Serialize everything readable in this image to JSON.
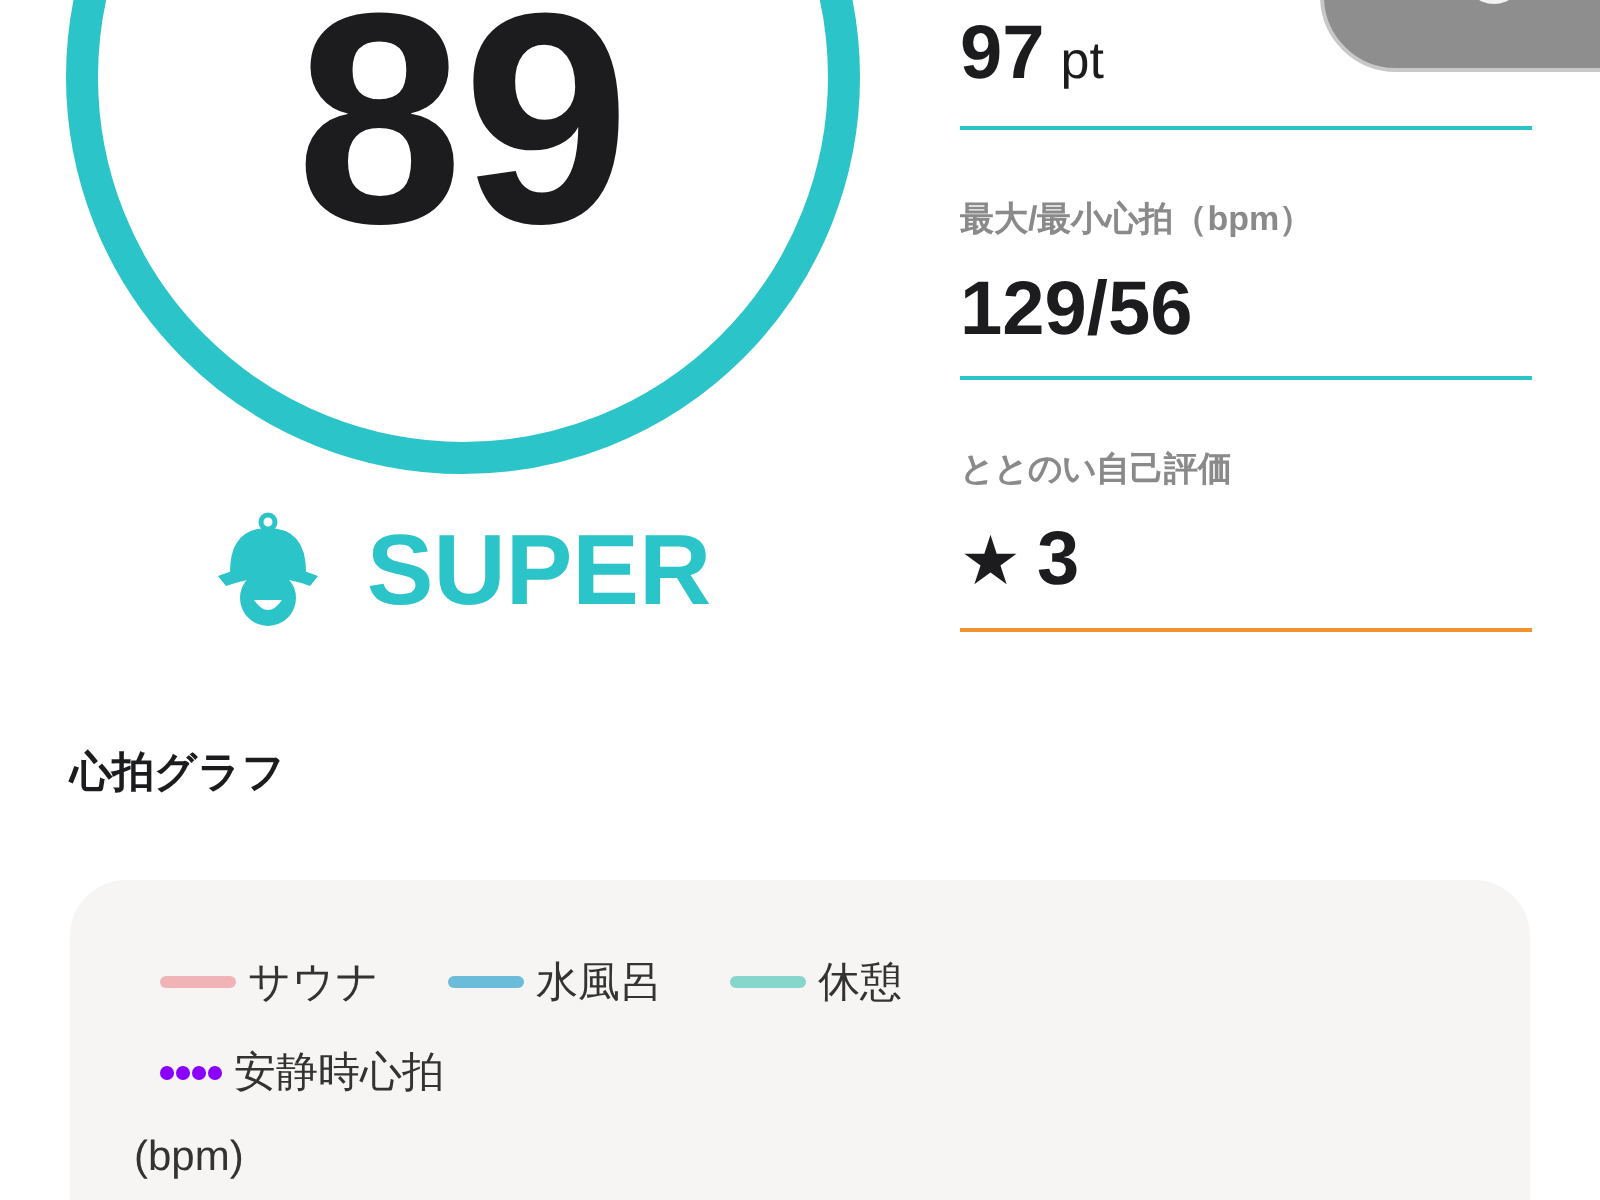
{
  "score": {
    "value": "89",
    "grade": "SUPER"
  },
  "stats": [
    {
      "kind": "points",
      "value": "97",
      "unit": "pt",
      "color": "#2bc4c8"
    },
    {
      "kind": "plain",
      "label": "最大/最小心拍（bpm）",
      "value": "129/56",
      "color": "#2bc4c8"
    },
    {
      "kind": "rating",
      "label": "ととのい自己評価",
      "symbol": "★",
      "value": "3",
      "color": "#f0922e"
    }
  ],
  "heart_rate_graph": {
    "title": "心拍グラフ",
    "legend": [
      {
        "kind": "line",
        "label": "サウナ",
        "color": "#f0b4b8"
      },
      {
        "kind": "line",
        "label": "水風呂",
        "color": "#6bbcd9"
      },
      {
        "kind": "line",
        "label": "休憩",
        "color": "#86d6cc"
      },
      {
        "kind": "dots",
        "label": "安静時心拍",
        "color": "#8a00ff"
      }
    ],
    "y_unit": "(bpm)"
  }
}
